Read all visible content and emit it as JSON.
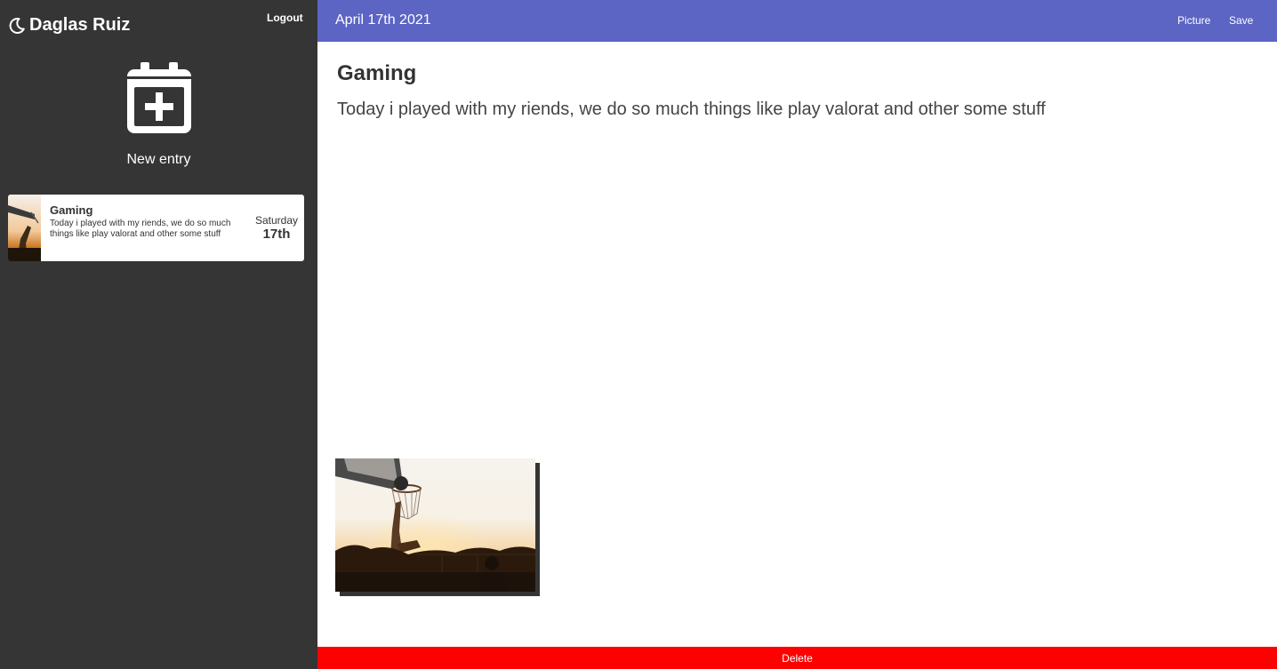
{
  "user": {
    "name": "Daglas Ruiz",
    "logout_label": "Logout",
    "icon": "moon-icon"
  },
  "sidebar": {
    "new_entry_label": "New entry",
    "new_entry_icon": "calendar-plus-icon",
    "entries": [
      {
        "title": "Gaming",
        "excerpt": "Today i played with my riends, we do so much things like play valorat and other some stuff",
        "weekday": "Saturday",
        "day": "17th",
        "thumbnail": "basketball-sunset-photo"
      }
    ]
  },
  "header": {
    "date": "April 17th 2021",
    "picture_label": "Picture",
    "save_label": "Save",
    "color": "#5c64c4"
  },
  "entry": {
    "title": "Gaming",
    "body": "Today i played with my riends, we do so much things like play valorat and other some stuff",
    "image": "basketball-sunset-photo"
  },
  "footer": {
    "delete_label": "Delete",
    "color": "#ff0000"
  },
  "colors": {
    "sidebar_bg": "#353535",
    "accent": "#5c64c4",
    "danger": "#ff0000"
  }
}
